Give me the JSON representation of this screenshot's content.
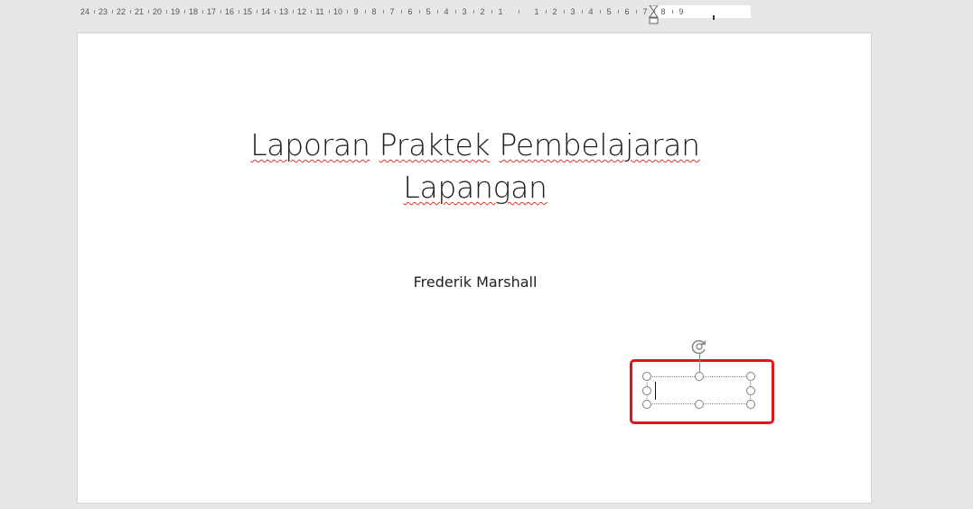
{
  "ruler": {
    "labels": [
      "24",
      "23",
      "22",
      "21",
      "20",
      "19",
      "18",
      "17",
      "16",
      "15",
      "14",
      "13",
      "12",
      "11",
      "10",
      "9",
      "8",
      "7",
      "6",
      "5",
      "4",
      "3",
      "2",
      "1",
      "1",
      "2",
      "3",
      "4",
      "5",
      "6",
      "7",
      "8",
      "9"
    ]
  },
  "slide": {
    "title_line1_words": [
      "Laporan",
      "Praktek",
      "Pembelajaran"
    ],
    "title_line2": "Lapangan",
    "subtitle": "Frederik Marshall"
  },
  "textbox": {
    "text": ""
  },
  "icons": {
    "rotate": "rotate-icon",
    "indent": "indent-marker-icon"
  },
  "colors": {
    "page_background": "#e6e6e6",
    "slide_background": "#ffffff",
    "highlight": "#e0161c",
    "spellcheck": "#d9342b"
  }
}
